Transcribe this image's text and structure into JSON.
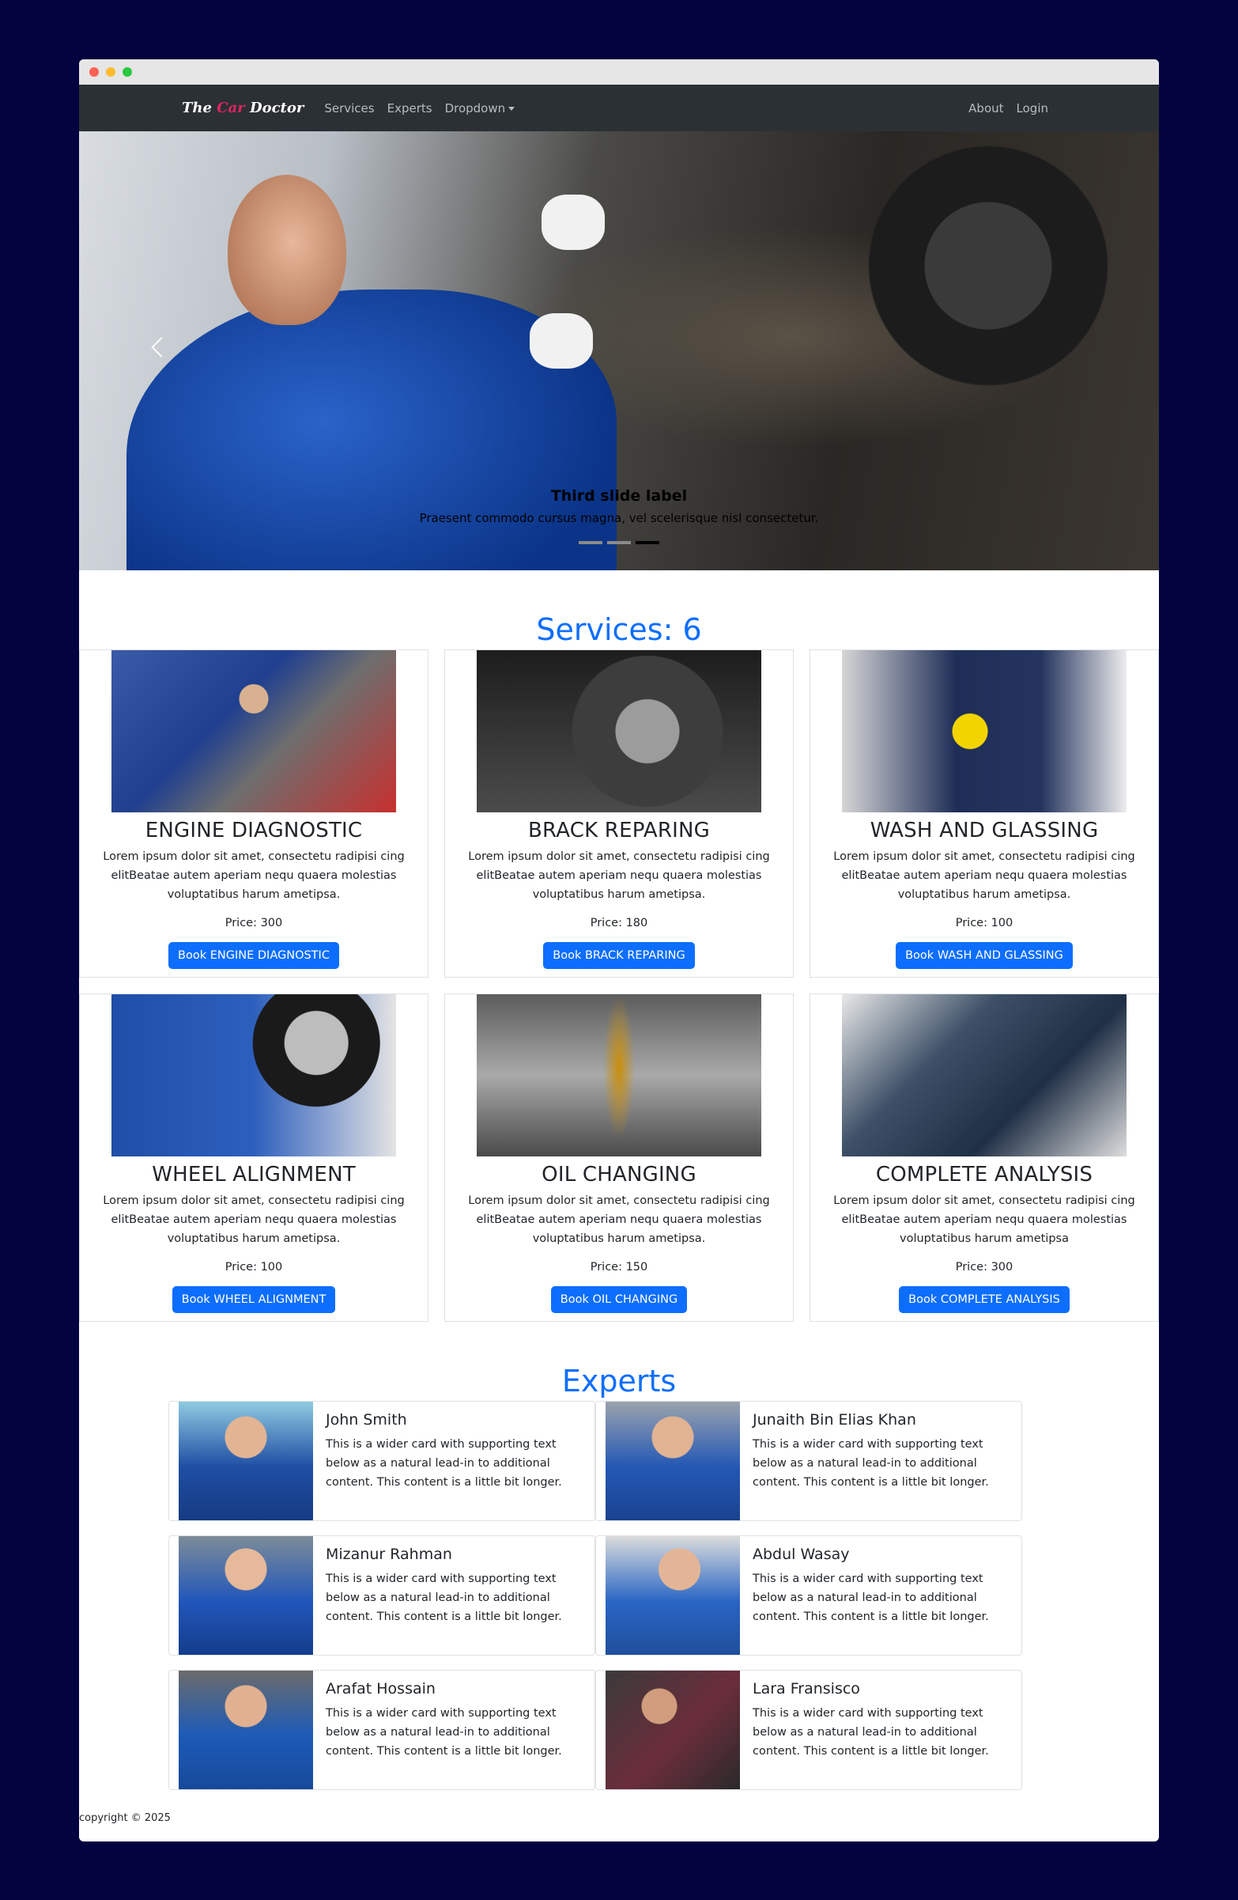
{
  "window": {
    "controls": [
      {
        "name": "close",
        "color": "#ff5f57"
      },
      {
        "name": "minimize",
        "color": "#febc2e"
      },
      {
        "name": "maximize",
        "color": "#28c840"
      }
    ]
  },
  "nav": {
    "brand": {
      "part1": "The ",
      "part2": "Car ",
      "part3": "Doctor"
    },
    "links": [
      "Services",
      "Experts",
      "Dropdown"
    ],
    "right_links": [
      "About",
      "Login"
    ]
  },
  "carousel": {
    "caption_title": "Third slide label",
    "caption_text": "Praesent commodo cursus magna, vel scelerisque nisl consectetur.",
    "indicators": 3,
    "active_index": 2
  },
  "services": {
    "title": "Services: 6",
    "items": [
      {
        "name": "ENGINE DIAGNOSTIC",
        "description": "Lorem ipsum dolor sit amet, consectetu radipisi cing elitBeatae autem aperiam nequ quaera molestias voluptatibus harum ametipsa.",
        "price": "Price: 300",
        "button": "Book ENGINE DIAGNOSTIC"
      },
      {
        "name": "BRACK REPARING",
        "description": "Lorem ipsum dolor sit amet, consectetu radipisi cing elitBeatae autem aperiam nequ quaera molestias voluptatibus harum ametipsa.",
        "price": "Price: 180",
        "button": "Book BRACK REPARING"
      },
      {
        "name": "WASH AND GLASSING",
        "description": "Lorem ipsum dolor sit amet, consectetu radipisi cing elitBeatae autem aperiam nequ quaera molestias voluptatibus harum ametipsa.",
        "price": "Price: 100",
        "button": "Book WASH AND GLASSING"
      },
      {
        "name": "WHEEL ALIGNMENT",
        "description": "Lorem ipsum dolor sit amet, consectetu radipisi cing elitBeatae autem aperiam nequ quaera molestias voluptatibus harum ametipsa.",
        "price": "Price: 100",
        "button": "Book WHEEL ALIGNMENT"
      },
      {
        "name": "OIL CHANGING",
        "description": "Lorem ipsum dolor sit amet, consectetu radipisi cing elitBeatae autem aperiam nequ quaera molestias voluptatibus harum ametipsa.",
        "price": "Price: 150",
        "button": "Book OIL CHANGING"
      },
      {
        "name": "COMPLETE ANALYSIS",
        "description": "Lorem ipsum dolor sit amet, consectetu radipisi cing elitBeatae autem aperiam nequ quaera molestias voluptatibus harum ametipsa",
        "price": "Price: 300",
        "button": "Book COMPLETE ANALYSIS"
      }
    ]
  },
  "experts": {
    "title": "Experts",
    "items": [
      {
        "name": "John Smith",
        "text": "This is a wider card with supporting text below as a natural lead-in to additional content. This content is a little bit longer."
      },
      {
        "name": "Junaith Bin Elias Khan",
        "text": "This is a wider card with supporting text below as a natural lead-in to additional content. This content is a little bit longer."
      },
      {
        "name": "Mizanur Rahman",
        "text": "This is a wider card with supporting text below as a natural lead-in to additional content. This content is a little bit longer."
      },
      {
        "name": "Abdul Wasay",
        "text": "This is a wider card with supporting text below as a natural lead-in to additional content. This content is a little bit longer."
      },
      {
        "name": "Arafat Hossain",
        "text": "This is a wider card with supporting text below as a natural lead-in to additional content. This content is a little bit longer."
      },
      {
        "name": "Lara Fransisco",
        "text": "This is a wider card with supporting text below as a natural lead-in to additional content. This content is a little bit longer."
      }
    ]
  },
  "footer": {
    "text": "copyright © 2025"
  },
  "colors": {
    "accent": "#0d6efd",
    "navbar": "#2b3035",
    "background": "#03033f"
  }
}
